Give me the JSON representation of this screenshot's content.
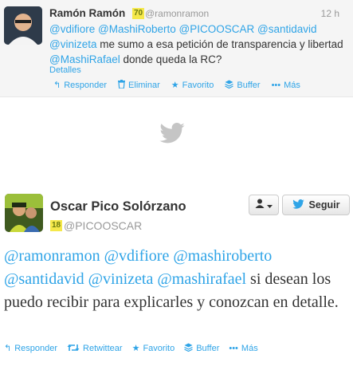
{
  "reply": {
    "name": "Ramón Ramón",
    "badge": "70",
    "handle": "@ramonramon",
    "time": "12 h",
    "mentions": [
      "@vdifiore",
      "@MashiRoberto",
      "@PICOOSCAR",
      "@santidavid",
      "@vinizeta"
    ],
    "text_part1": "me sumo a esa petición de transparencia y libertad",
    "mention_rafael": "@MashiRafael",
    "text_part2": "donde queda la RC?",
    "details": "Detalles",
    "actions": {
      "reply": "Responder",
      "delete": "Eliminar",
      "favorite": "Favorito",
      "buffer": "Buffer",
      "more": "Más"
    }
  },
  "tweet": {
    "name": "Oscar Pico Solórzano",
    "badge": "18",
    "handle": "@PICOOSCAR",
    "follow_label": "Seguir",
    "mentions": [
      "@ramonramon",
      "@vdifiore",
      "@mashiroberto",
      "@santidavid",
      "@vinizeta",
      "@mashirafael"
    ],
    "text": "si desean los puedo recibir para explicarles y conozcan en detalle.",
    "actions": {
      "reply": "Responder",
      "retweet": "Retwittear",
      "favorite": "Favorito",
      "buffer": "Buffer",
      "more": "Más"
    }
  },
  "colors": {
    "link": "#2fa4e7",
    "badge_bg": "#f5e84a",
    "reply_bg": "#f5f5f5"
  }
}
